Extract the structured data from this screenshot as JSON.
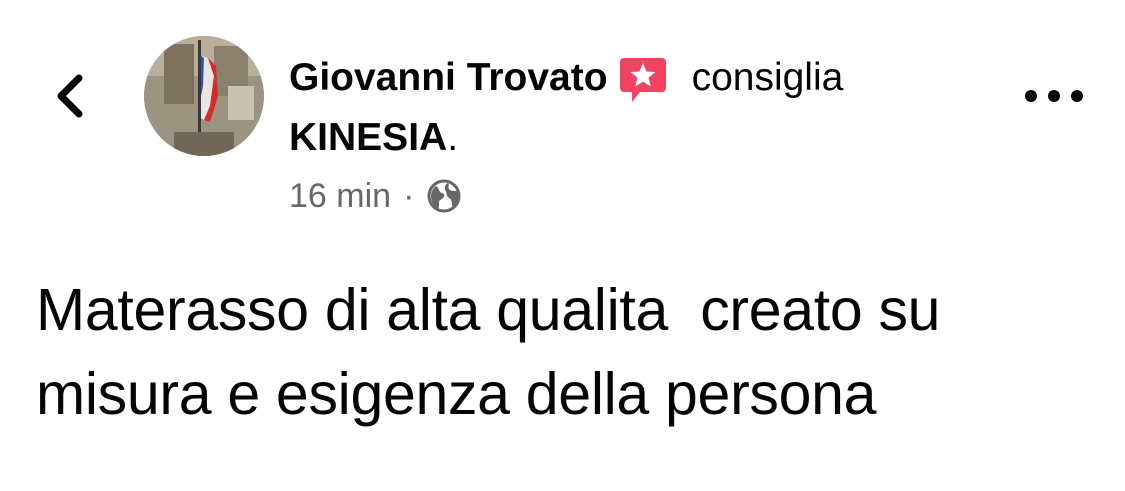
{
  "header": {
    "author_name": "Giovanni Trovato",
    "badge_icon": "recommendation-star-icon",
    "action": "consiglia",
    "page_name": "KINESIA",
    "page_suffix": "."
  },
  "meta": {
    "time": "16 min",
    "separator": "·",
    "audience_icon": "globe-icon"
  },
  "post": {
    "text": "Materasso di alta qualita  creato su\nmisura e esigenza della persona"
  },
  "icons": {
    "back": "chevron-left-icon",
    "more": "more-options-icon"
  },
  "colors": {
    "badge": "#f3425f",
    "secondary_text": "#65676b",
    "primary_text": "#050505"
  }
}
